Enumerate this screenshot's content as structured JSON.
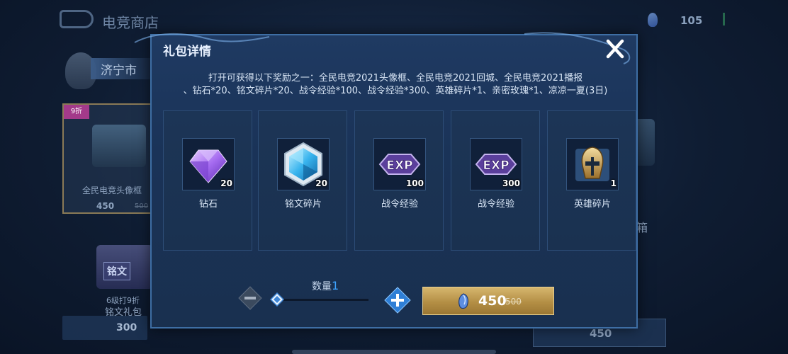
{
  "background": {
    "title": "电竞商店",
    "currency": "105",
    "city": "济宁市",
    "card": {
      "tag": "9折",
      "name": "全民电竞头像框",
      "price": "450",
      "orig": "500"
    },
    "left_gift": {
      "chest_label": "铭文",
      "discount": "6级打9折",
      "name": "铭文礼包",
      "price": "300"
    },
    "right_label": "箱",
    "right_price": "450"
  },
  "dialog": {
    "title": "礼包详情",
    "description_line1": "打开可获得以下奖励之一：全民电竞2021头像框、全民电竞2021回城、全民电竞2021播报",
    "description_line2": "、钻石*20、铭文碎片*20、战令经验*100、战令经验*300、英雄碎片*1、亲密玫瑰*1、凉凉一夏(3日)",
    "rewards": [
      {
        "name": "钻石",
        "count": "20",
        "icon": "diamond-icon"
      },
      {
        "name": "铭文碎片",
        "count": "20",
        "icon": "inscription-shard-icon"
      },
      {
        "name": "战令经验",
        "count": "100",
        "icon": "exp-icon"
      },
      {
        "name": "战令经验",
        "count": "300",
        "icon": "exp-icon"
      },
      {
        "name": "英雄碎片",
        "count": "1",
        "icon": "hero-shard-icon"
      }
    ],
    "quantity_label": "数量",
    "quantity_value": "1",
    "buy_price": "450",
    "buy_orig_price": "500"
  },
  "colors": {
    "accent_blue": "#3ea3ff",
    "gold_button": "#c7a55c",
    "dialog_bg": "#1b3457"
  }
}
